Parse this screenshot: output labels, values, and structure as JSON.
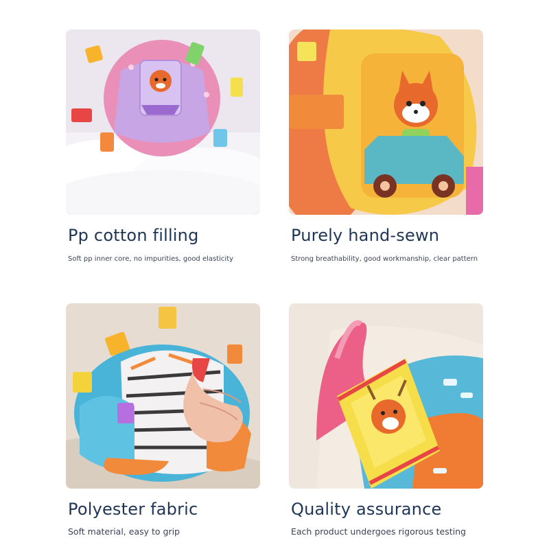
{
  "features": [
    {
      "title": "Pp cotton filling",
      "description": "Soft pp inner core, no impurities, good elasticity",
      "image": "plush-ball-on-cotton"
    },
    {
      "title": "Purely hand-sewn",
      "description": "Strong breathability, good workmanship, clear pattern",
      "image": "fox-car-embroidery-closeup"
    },
    {
      "title": "Polyester fabric",
      "description": "Soft material, easy to grip",
      "image": "hand-gripping-zebra-ball"
    },
    {
      "title": "Quality assurance",
      "description": "Each product undergoes rigorous testing",
      "image": "deer-ribbon-tag-closeup"
    }
  ],
  "colors": {
    "title": "#1f3558",
    "description": "#3b4252",
    "background": "#ffffff"
  }
}
